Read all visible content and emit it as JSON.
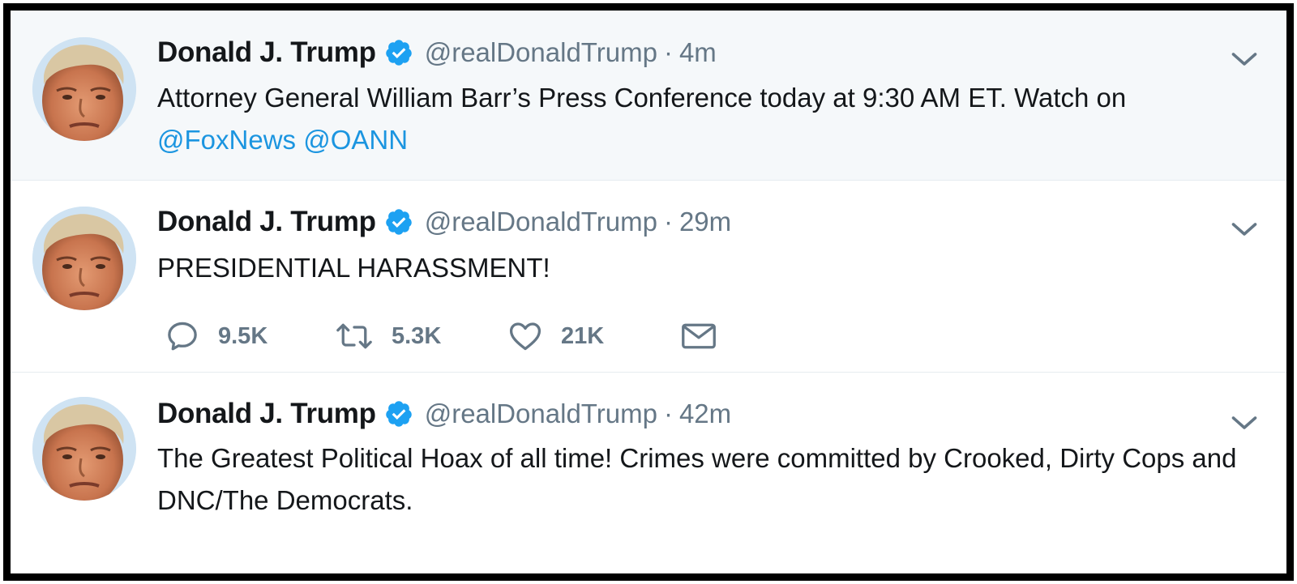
{
  "tweets": [
    {
      "name": "Donald J. Trump",
      "handle": "@realDonaldTrump",
      "separator": "·",
      "time": "4m",
      "text": "Attorney General William Barr’s Press Conference today at 9:30 AM ET. Watch on",
      "mentions": [
        "@FoxNews",
        "@OANN"
      ],
      "verified_icon": "verified-badge-icon",
      "menu_icon": "chevron-down-icon"
    },
    {
      "name": "Donald J. Trump",
      "handle": "@realDonaldTrump",
      "separator": "·",
      "time": "29m",
      "text": "PRESIDENTIAL HARASSMENT!",
      "actions": {
        "replies": "9.5K",
        "retweets": "5.3K",
        "likes": "21K"
      },
      "verified_icon": "verified-badge-icon",
      "menu_icon": "chevron-down-icon"
    },
    {
      "name": "Donald J. Trump",
      "handle": "@realDonaldTrump",
      "separator": "·",
      "time": "42m",
      "text": "The Greatest Political Hoax of all time! Crimes were committed by Crooked, Dirty Cops and DNC/The Democrats.",
      "verified_icon": "verified-badge-icon",
      "menu_icon": "chevron-down-icon"
    }
  ],
  "colors": {
    "link": "#1b95e0",
    "verified": "#1da1f2",
    "muted": "#657786",
    "text": "#14171a",
    "highlight_bg": "#f5f8fa",
    "border": "#000000"
  }
}
